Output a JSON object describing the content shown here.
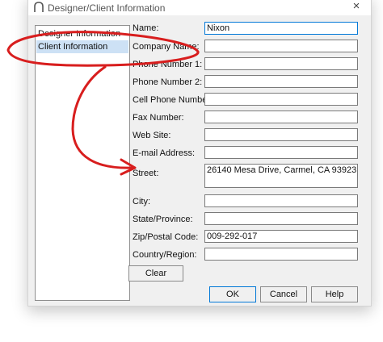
{
  "window": {
    "title": "Designer/Client Information",
    "close_symbol": "×"
  },
  "nav": {
    "items": [
      {
        "label": "Designer Information",
        "selected": false
      },
      {
        "label": "Client Information",
        "selected": true
      }
    ]
  },
  "form": {
    "name": {
      "label": "Name:",
      "value": "Nixon"
    },
    "company_name": {
      "label": "Company Name:",
      "value": ""
    },
    "phone1": {
      "label": "Phone Number 1:",
      "value": ""
    },
    "phone2": {
      "label": "Phone Number 2:",
      "value": ""
    },
    "cell": {
      "label": "Cell Phone Number:",
      "value": ""
    },
    "fax": {
      "label": "Fax Number:",
      "value": ""
    },
    "website": {
      "label": "Web Site:",
      "value": ""
    },
    "email": {
      "label": "E-mail Address:",
      "value": ""
    },
    "street": {
      "label": "Street:",
      "value": "26140 Mesa Drive, Carmel, CA 93923"
    },
    "city": {
      "label": "City:",
      "value": ""
    },
    "state": {
      "label": "State/Province:",
      "value": ""
    },
    "zip": {
      "label": "Zip/Postal Code:",
      "value": "009-292-017"
    },
    "country": {
      "label": "Country/Region:",
      "value": ""
    }
  },
  "buttons": {
    "clear": "Clear",
    "ok": "OK",
    "cancel": "Cancel",
    "help": "Help"
  },
  "annotation": {
    "color": "#d81e1e"
  }
}
